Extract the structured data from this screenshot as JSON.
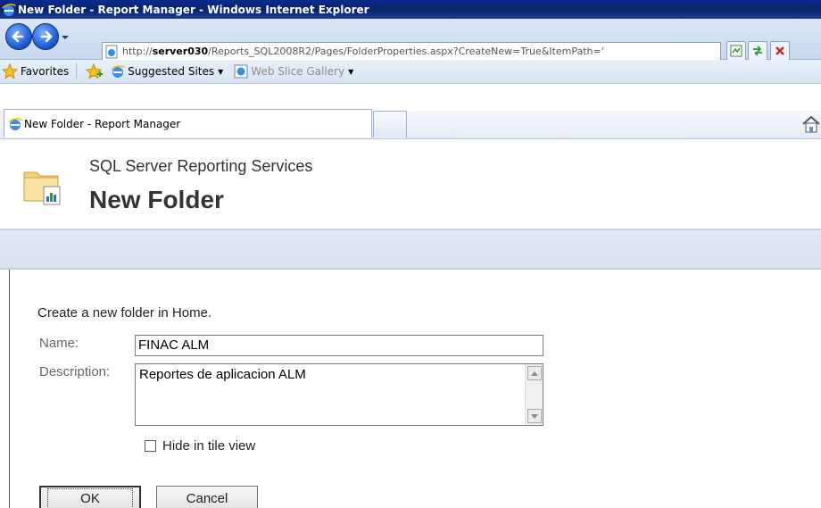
{
  "window": {
    "title": "New Folder - Report Manager - Windows Internet Explorer"
  },
  "address": {
    "prefix": "http://",
    "host": "server030",
    "path": "/Reports_SQL2008R2/Pages/FolderProperties.aspx?CreateNew=True&ItemPath='"
  },
  "favorites": {
    "label": "Favorites",
    "items": [
      {
        "label": "Suggested Sites",
        "icon": "ie-icon"
      },
      {
        "label": "Web Slice Gallery",
        "icon": "ie-page-icon"
      }
    ]
  },
  "tabs": [
    {
      "label": "New Folder - Report Manager",
      "active": true
    }
  ],
  "header": {
    "product": "SQL Server Reporting Services",
    "title": "New Folder"
  },
  "form": {
    "intro": "Create a new folder in Home.",
    "name_label": "Name:",
    "name_value": "FINAC ALM",
    "description_label": "Description:",
    "description_value": "Reportes de aplicacion ALM",
    "hide_label": "Hide in tile view",
    "hide_checked": false,
    "ok_label": "OK",
    "cancel_label": "Cancel"
  },
  "colors": {
    "titlebar": "#0a246a",
    "ribbon": "#dde4f4",
    "accent": "#1f5fd8"
  }
}
